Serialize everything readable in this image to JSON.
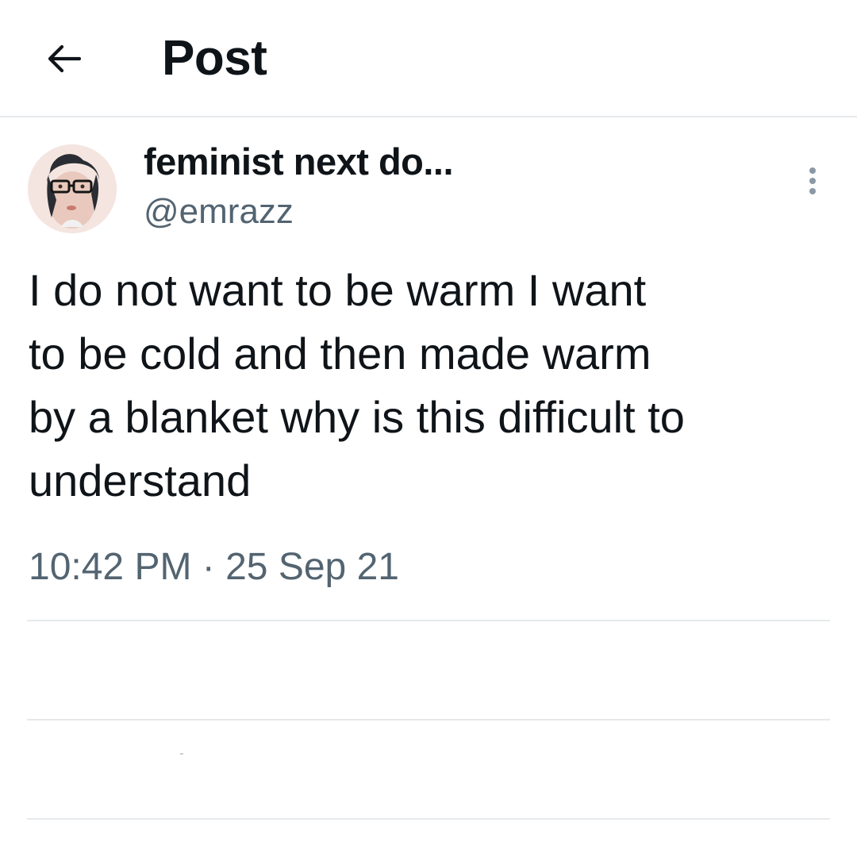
{
  "header": {
    "back_icon": "arrow-left-icon",
    "title": "Post"
  },
  "post": {
    "author": {
      "display_name": "feminist next do...",
      "handle": "@emrazz",
      "avatar": "user-avatar"
    },
    "more_icon": "more-vertical-icon",
    "text_lines": [
      "I do not want to be warm I want",
      "to be cold and then made warm",
      "by a blanket why is this difficult to",
      "understand"
    ],
    "timestamp": "10:42 PM · 25 Sep 21"
  },
  "colors": {
    "text_primary": "#0f1419",
    "text_secondary": "#536471",
    "divider": "#e6e9ec"
  }
}
